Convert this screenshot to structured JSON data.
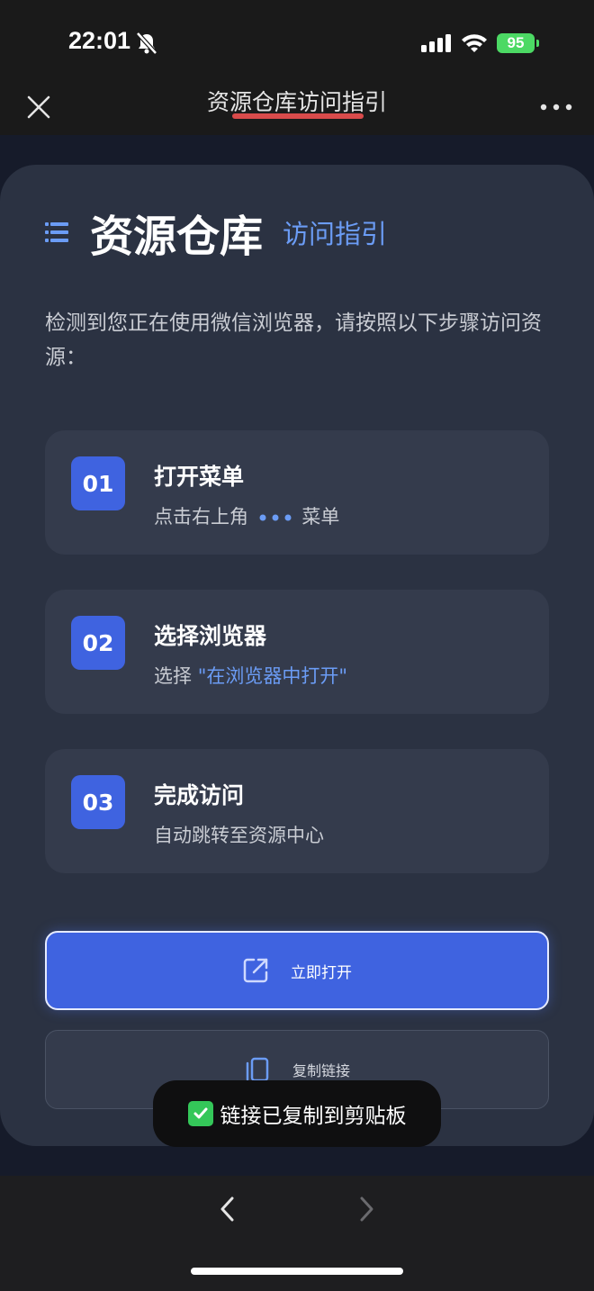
{
  "status_bar": {
    "time": "22:01",
    "battery": "95"
  },
  "nav": {
    "title": "资源仓库访问指引"
  },
  "hero": {
    "title": "资源仓库",
    "subtitle": "访问指引"
  },
  "intro": "检测到您正在使用微信浏览器，请按照以下步骤访问资源：",
  "steps": [
    {
      "num": "01",
      "title": "打开菜单",
      "desc_prefix": "点击右上角",
      "desc_suffix": "菜单"
    },
    {
      "num": "02",
      "title": "选择浏览器",
      "desc_prefix": "选择 ",
      "desc_accent": "\"在浏览器中打开\""
    },
    {
      "num": "03",
      "title": "完成访问",
      "desc": "自动跳转至资源中心"
    }
  ],
  "buttons": {
    "open_label": "立即打开",
    "copy_label": "复制链接"
  },
  "toast": "链接已复制到剪贴板",
  "colors": {
    "accent": "#3f63e0",
    "accent_text": "#6b9cf5",
    "card": "#2b3242",
    "step_card": "#343b4c",
    "page_bg": "#161b2a"
  },
  "icons": {
    "close": "close-icon",
    "more": "more-icon",
    "list": "list-icon",
    "open": "external-link-icon",
    "copy": "copy-icon",
    "check": "check-icon",
    "back": "chevron-left-icon",
    "forward": "chevron-right-icon"
  }
}
